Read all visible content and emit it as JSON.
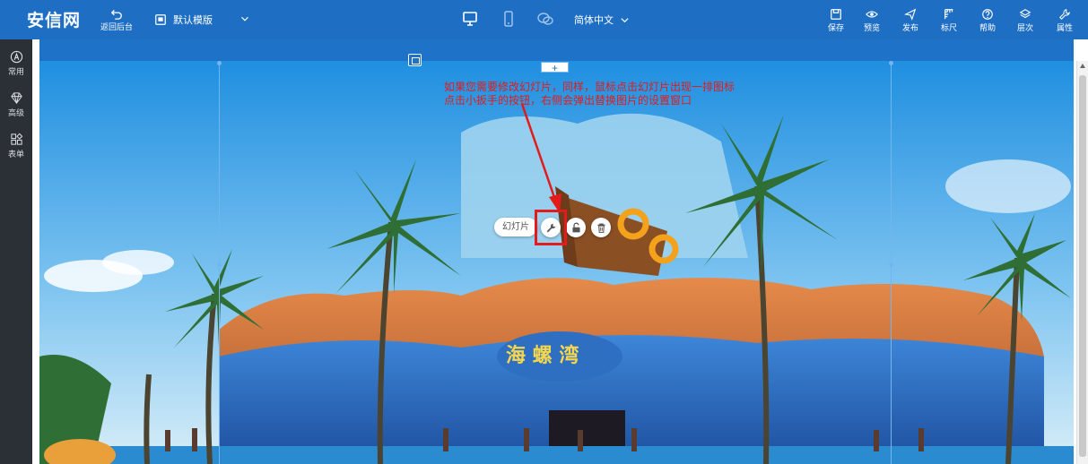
{
  "app": {
    "logo": "安信网"
  },
  "toolbar": {
    "back_label": "返回后台",
    "template_label": "默认模版",
    "language_label": "简体中文",
    "save_label": "保存",
    "preview_label": "预览",
    "publish_label": "发布",
    "ruler_label": "标尺",
    "help_label": "帮助",
    "layers_label": "层次",
    "properties_label": "属性"
  },
  "sidebar": {
    "items": [
      {
        "label": "常用",
        "icon": "circle-a-icon"
      },
      {
        "label": "高级",
        "icon": "diamond-icon"
      },
      {
        "label": "表单",
        "icon": "grid-icon"
      }
    ]
  },
  "canvas": {
    "plus_label": "+",
    "hint_line1": "如果您需要修改幻灯片，同样，鼠标点击幻灯片出现一排图标",
    "hint_line2": "点击小扳手的按钮，右侧会弹出替换图片的设置窗口",
    "slide_label": "幻灯片"
  },
  "colors": {
    "toolbar_bg": "#1e6fc4",
    "sidebar_bg": "#2b2f36",
    "hint_text": "#e31b1b",
    "guide": "#73b6ee"
  }
}
